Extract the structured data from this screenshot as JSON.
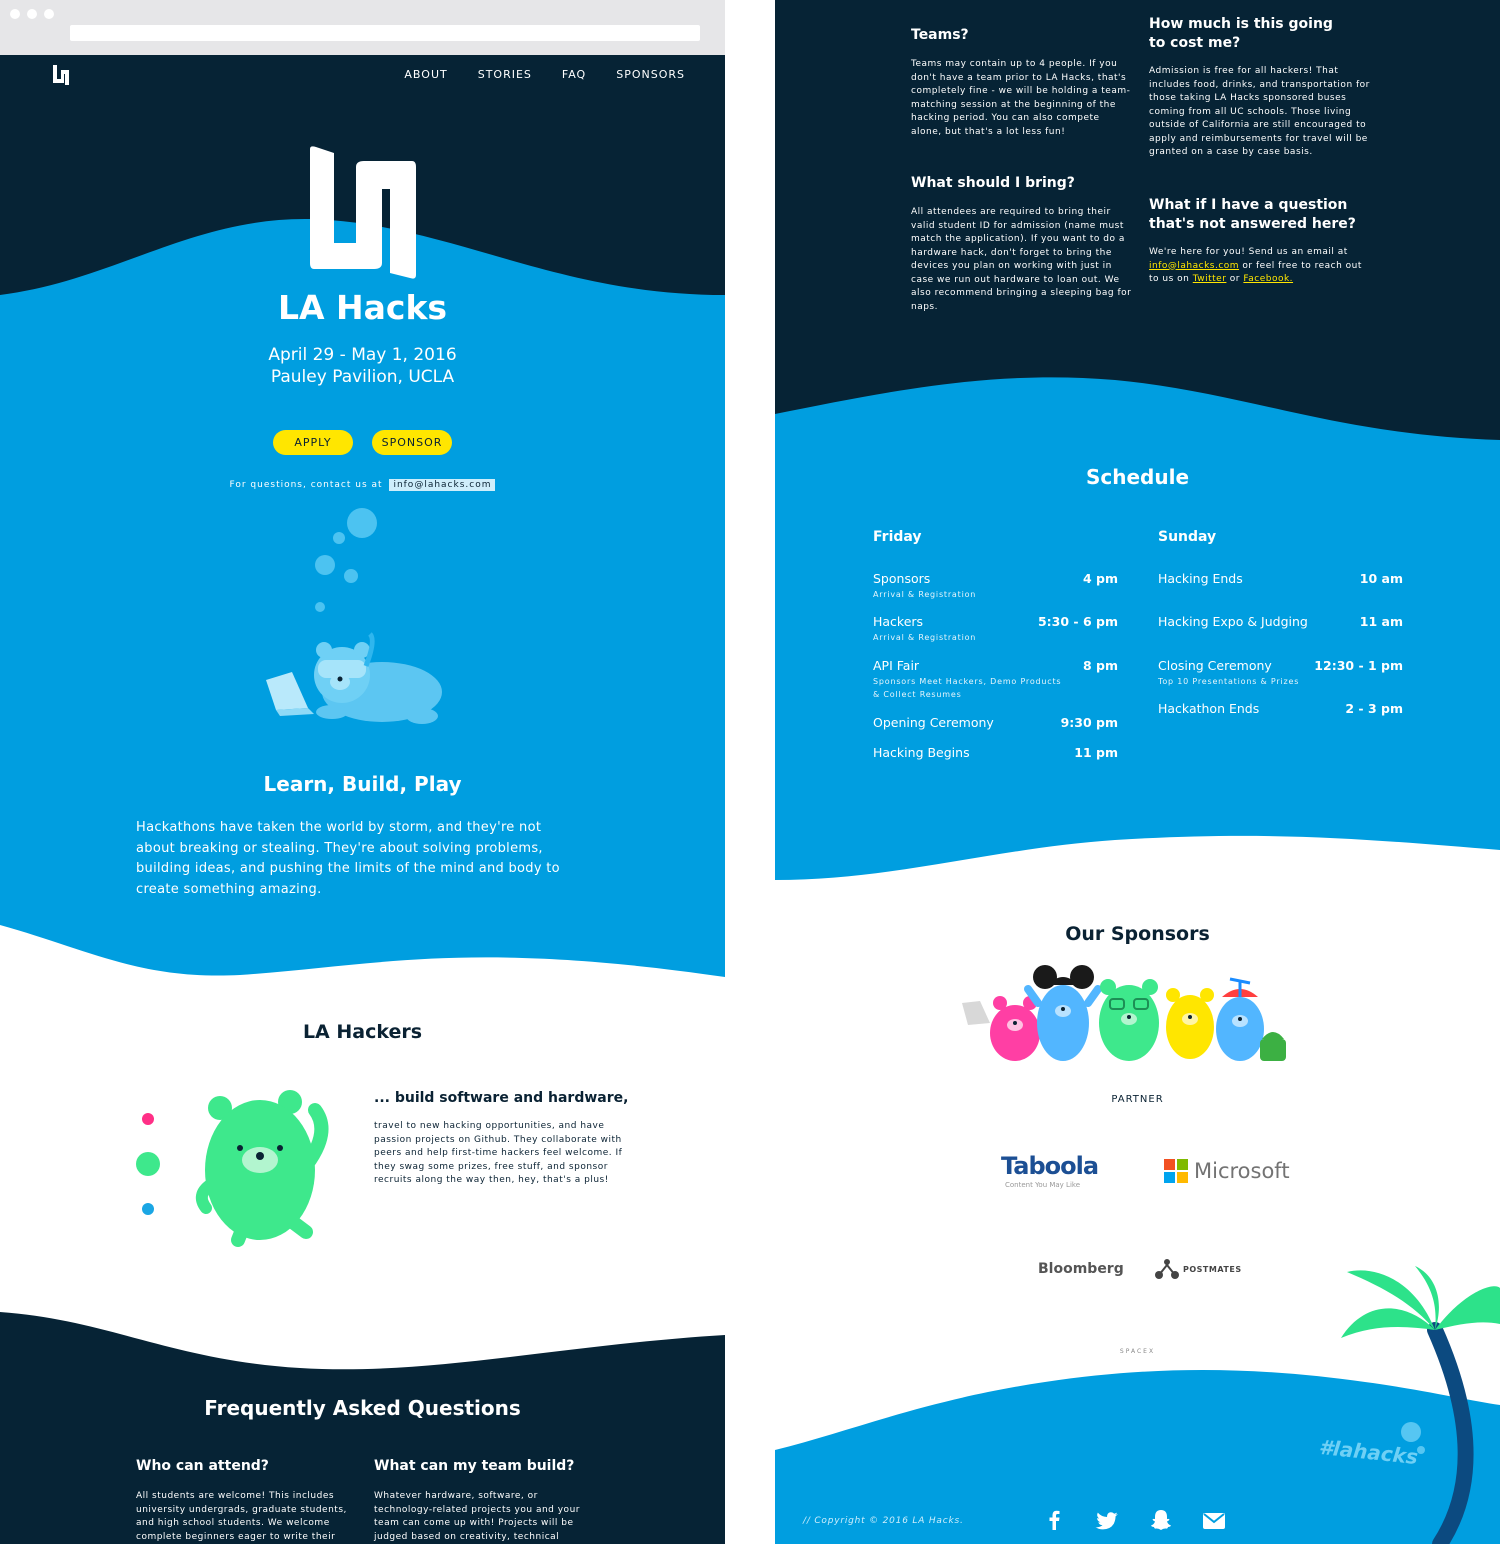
{
  "nav": {
    "items": [
      "ABOUT",
      "STORIES",
      "FAQ",
      "SPONSORS"
    ]
  },
  "hero": {
    "title": "LA Hacks",
    "dates": "April 29 - May 1, 2016",
    "venue": "Pauley Pavilion, UCLA",
    "apply_label": "APPLY",
    "sponsor_label": "SPONSOR",
    "contact_prefix": "For questions, contact us at",
    "contact_email": "info@lahacks.com"
  },
  "about": {
    "title": "Learn, Build, Play",
    "body": "Hackathons have taken the world by storm, and they're not about breaking or stealing. They're about solving problems, building ideas, and pushing the limits of the mind and body to create something amazing."
  },
  "hackers": {
    "title": "LA Hackers",
    "subtitle": "... build software and hardware,",
    "body": "travel to new hacking opportunities, and have passion projects on Github. They collaborate with peers and help first-time hackers feel welcome. If they swag some prizes, free stuff, and sponsor recruits along the way then, hey, that's a plus!"
  },
  "faq": {
    "title": "Frequently Asked Questions",
    "items": [
      {
        "q": "Who can attend?",
        "a": "All students are welcome! This includes university undergrads, graduate students, and high school students. We welcome complete beginners eager to write their"
      },
      {
        "q": "What can my team build?",
        "a": "Whatever hardware, software, or technology-related projects you and your team can come up with! Projects will be judged based on creativity, technical"
      },
      {
        "q": "Teams?",
        "a": "Teams may contain up to 4 people. If you don't have a team prior to LA Hacks, that's completely fine - we will be holding a team-matching session at the beginning of the hacking period. You can also compete alone, but that's a lot less fun!"
      },
      {
        "q": "What should I bring?",
        "a": "All attendees are required to bring their valid student ID for admission (name must match the application). If you want to do a hardware hack, don't forget to bring the devices you plan on working with just in case we run out hardware to loan out. We also recommend bringing a sleeping bag for naps."
      },
      {
        "q": "How much is this going to cost me?",
        "a": "Admission is free for all hackers! That includes food, drinks, and transportation for those taking LA Hacks sponsored buses coming from all UC schools. Those living outside of California are still encouraged to apply and reimbursements for travel will be granted on a case by case basis."
      },
      {
        "q": "What if I have a question that's not answered here?",
        "a_pre": "We're here for you! Send us an email at",
        "a_email": "info@lahacks.com",
        "a_mid": "or feel free to reach out to us on",
        "a_twitter": "Twitter",
        "a_or": "or",
        "a_facebook": "Facebook."
      }
    ]
  },
  "schedule": {
    "title": "Schedule",
    "days": [
      {
        "name": "Friday",
        "events": [
          {
            "name": "Sponsors",
            "sub": "Arrival & Registration",
            "time": "4 pm"
          },
          {
            "name": "Hackers",
            "sub": "Arrival & Registration",
            "time": "5:30 - 6 pm"
          },
          {
            "name": "API Fair",
            "sub": "Sponsors Meet Hackers, Demo Products & Collect Resumes",
            "time": "8 pm"
          },
          {
            "name": "Opening Ceremony",
            "sub": "",
            "time": "9:30 pm"
          },
          {
            "name": "Hacking Begins",
            "sub": "",
            "time": "11 pm"
          }
        ]
      },
      {
        "name": "Sunday",
        "events": [
          {
            "name": "Hacking Ends",
            "sub": "",
            "time": "10 am"
          },
          {
            "name": "Hacking Expo & Judging",
            "sub": "",
            "time": "11 am"
          },
          {
            "name": "Closing Ceremony",
            "sub": "Top 10 Presentations & Prizes",
            "time": "12:30 - 1 pm"
          },
          {
            "name": "Hackathon Ends",
            "sub": "",
            "time": "2 - 3 pm"
          }
        ]
      }
    ]
  },
  "sponsors": {
    "title": "Our Sponsors",
    "partner_label": "PARTNER",
    "logos": [
      "Taboola",
      "Content You May Like",
      "Microsoft",
      "Bloomberg",
      "POSTMATES",
      "SPACEX"
    ]
  },
  "footer": {
    "hashtag": "#lahacks",
    "copyright": "// Copyright © 2016 LA Hacks.",
    "social": [
      "facebook-icon",
      "twitter-icon",
      "snapchat-icon",
      "mail-icon"
    ]
  },
  "colors": {
    "navy": "#062335",
    "blue": "#009ee0",
    "yellow": "#ffe600",
    "green": "#3ee88c"
  }
}
